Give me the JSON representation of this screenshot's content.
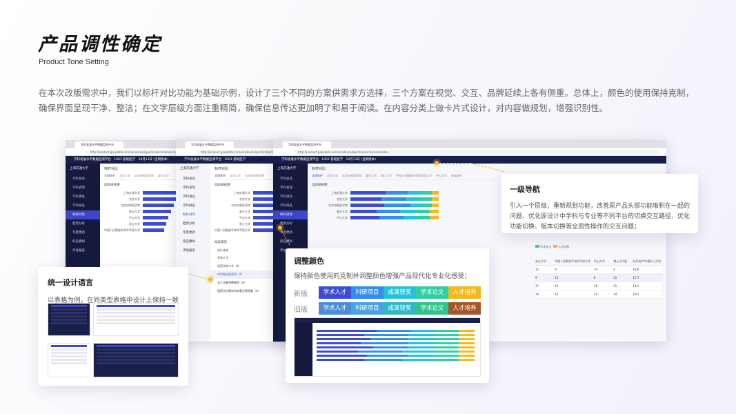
{
  "page": {
    "title": "产品调性确定",
    "subtitle": "Product Tone Setting",
    "intro": "在本次改版需求中，我们以标杆对比功能为基础示例，设计了三个不同的方案供需求方选择，三个方案在视觉、交互、品牌延续上各有侧重。总体上，颜色的使用保持克制，确保界面呈现干净、整洁；在文字层级方面注重精简，确保信息传达更加明了和易于阅读。在内容分类上做卡片式设计，对内容做规划，增强识别性。"
  },
  "browser": {
    "tab_label": "学科发展水平数据监测平台",
    "url": "http://product.gaojidata.com/ecadsu/subject/index/module/codes",
    "app_title": "学科发展水平数据监测平台",
    "app_menu": [
      "1001 基础医学",
      "10月13日 (当期版本)"
    ]
  },
  "sidebar": {
    "logo": "上海交通大学",
    "items": [
      "学科总览",
      "学科表现",
      "学科演化",
      "学科排名",
      "标杆对比",
      "趋势分析",
      "年度更新",
      "排名模拟",
      "评估报表"
    ]
  },
  "benchmark": {
    "heading": "标杆对比",
    "tabs": [
      "全国标杆",
      "北京大学",
      "北京协和医学院",
      "复旦大学",
      "浙江大学",
      "中国人民解放军海军军医大学",
      "中山大学",
      "查找标杆"
    ],
    "section": "动态排名图",
    "rows": [
      "上海交通大学",
      "北京大学",
      "北京协和医学院",
      "复旦大学",
      "中山大学",
      "浙江大学",
      "中国人民解放军海军军医大学"
    ],
    "section2": "动态排名",
    "list_header": "指标维度",
    "list_items": [
      "学术人才",
      "培养学术人才（A）",
      "中华医学奖奖项（A）",
      "长江学者特聘教授（A）",
      "国家杰出青年科学基金获得者（A）"
    ],
    "side_labels": [
      "排名",
      "标杆对比",
      "趋势分析",
      "年度更新",
      "排名模拟",
      "评估报表"
    ]
  },
  "card_nav": {
    "title": "一级导航",
    "desc": "引入一个层级，重新规划功能，改善原产品头部功能堆积在一起的问题、优化原设计中学科与专业等不同平台的切换交互路径、优化功能切换、版本切换等全局性操作的交互问题；"
  },
  "card_unify": {
    "title": "统一设计语言",
    "desc": "以表格为例，在同类型表格中设计上保持一致"
  },
  "card_color": {
    "title": "调整颜色",
    "desc": "保持颜色使用的克制并调整颜色增强产品现代化专业化感受；",
    "new_label": "新版",
    "old_label": "旧版",
    "new_palette": [
      {
        "label": "学术人才",
        "color": "#3c4cd4"
      },
      {
        "label": "科研项目",
        "color": "#2f8ef0"
      },
      {
        "label": "成果获奖",
        "color": "#22c3d8"
      },
      {
        "label": "学术论文",
        "color": "#2fd0a0"
      },
      {
        "label": "人才培养",
        "color": "#f5b81d"
      }
    ],
    "old_palette": [
      {
        "label": "学术人才",
        "color": "#4a8fd6"
      },
      {
        "label": "科研项目",
        "color": "#4aa3df"
      },
      {
        "label": "成果获奖",
        "color": "#2fb8c8"
      },
      {
        "label": "学术论文",
        "color": "#2fc48a"
      },
      {
        "label": "人才培养",
        "color": "#a5552a"
      }
    ]
  },
  "table_right": {
    "headers": [
      "浙江大学",
      "中国人民解放军海军军医大学",
      "中山大学",
      "博士点平衡",
      "标杆前20%相对上学科"
    ],
    "rows": [
      [
        "12",
        "6",
        "14",
        "4",
        "18.6"
      ],
      [
        "9",
        "13",
        "8",
        "25",
        "12.7"
      ],
      [
        "17",
        "12",
        "18",
        "21",
        "14.2"
      ],
      [
        "14",
        "14",
        "24",
        "24",
        "18.5"
      ]
    ],
    "legend": [
      "学术论文",
      "人才培养"
    ]
  }
}
